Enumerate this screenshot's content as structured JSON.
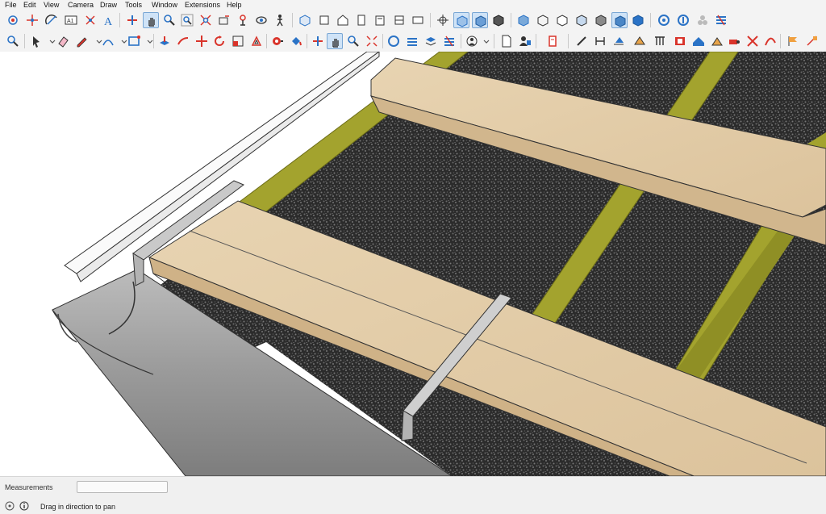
{
  "menu": [
    "File",
    "Edit",
    "View",
    "Camera",
    "Draw",
    "Tools",
    "Window",
    "Extensions",
    "Help"
  ],
  "status": {
    "measurements_label": "Measurements",
    "measurements_value": "",
    "hint": "Drag in direction to pan"
  },
  "colors": {
    "accent": "#d9342b",
    "blue": "#2b73c6",
    "active": "#cfe3f7",
    "wood": "#e2cba6",
    "batten": "#9a9a2a"
  }
}
